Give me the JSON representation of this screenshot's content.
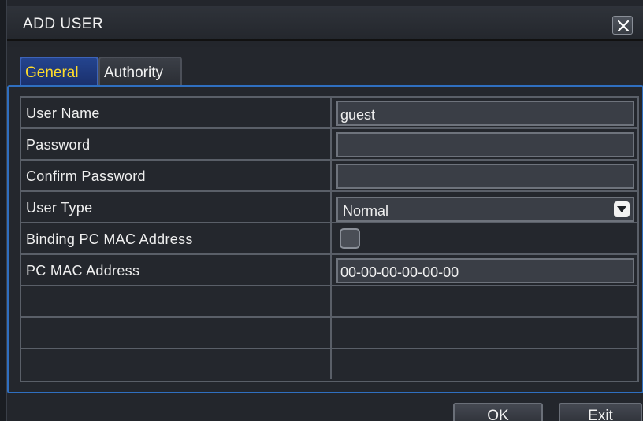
{
  "dialog": {
    "title": "ADD USER"
  },
  "tabs": [
    {
      "label": "General",
      "active": true
    },
    {
      "label": "Authority",
      "active": false
    }
  ],
  "form": {
    "rows": [
      {
        "label": "User Name",
        "value": "guest"
      },
      {
        "label": "Password",
        "value": ""
      },
      {
        "label": "Confirm Password",
        "value": ""
      },
      {
        "label": "User Type",
        "value": "Normal"
      },
      {
        "label": "Binding PC MAC Address",
        "checked": false
      },
      {
        "label": "PC MAC Address",
        "value": "00-00-00-00-00-00"
      }
    ]
  },
  "buttons": {
    "ok": "OK",
    "exit": "Exit"
  },
  "colors": {
    "active_tab_text": "#ffdc2a",
    "panel_border": "#2f6fc0"
  }
}
